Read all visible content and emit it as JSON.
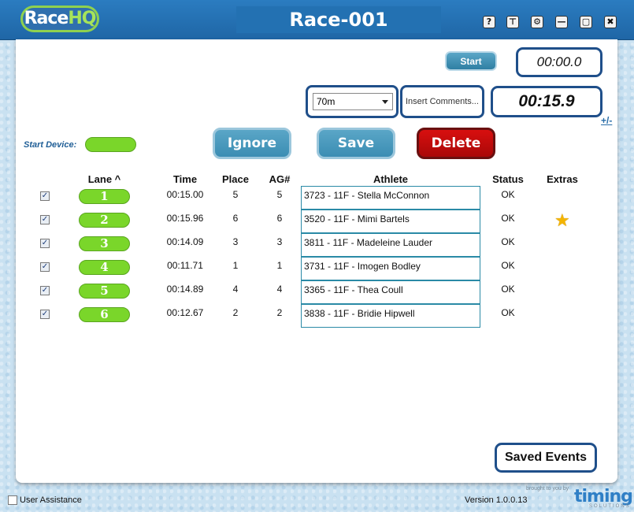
{
  "titlebar": {
    "logo_main": "Race",
    "logo_hq": "HQ",
    "title": "Race-001",
    "buttons": [
      {
        "name": "help-icon",
        "glyph": "?"
      },
      {
        "name": "filter-icon",
        "glyph": "⊤"
      },
      {
        "name": "gear-icon",
        "glyph": "⚙"
      },
      {
        "name": "minimize-icon",
        "glyph": "—"
      },
      {
        "name": "maximize-icon",
        "glyph": "▢"
      },
      {
        "name": "close-icon",
        "glyph": "✖"
      }
    ]
  },
  "controls": {
    "start_label": "Start",
    "timer_primary": "00:00.0",
    "timer_split": "00:15.9",
    "plus_minus": "+/-",
    "distance_selected": "70m",
    "comments_placeholder": "Insert Comments...",
    "start_device_label": "Start Device:",
    "ignore_label": "Ignore",
    "save_label": "Save",
    "delete_label": "Delete"
  },
  "table": {
    "headers": {
      "lane": "Lane ^",
      "time": "Time",
      "place": "Place",
      "ag": "AG#",
      "athlete": "Athlete",
      "status": "Status",
      "extras": "Extras"
    },
    "rows": [
      {
        "checked": true,
        "lane": "1",
        "time": "00:15.00",
        "place": "5",
        "ag": "5",
        "athlete": "3723 - 11F - Stella McConnon",
        "status": "OK",
        "extras_star": false
      },
      {
        "checked": true,
        "lane": "2",
        "time": "00:15.96",
        "place": "6",
        "ag": "6",
        "athlete": "3520 - 11F - Mimi Bartels",
        "status": "OK",
        "extras_star": true
      },
      {
        "checked": true,
        "lane": "3",
        "time": "00:14.09",
        "place": "3",
        "ag": "3",
        "athlete": "3811 - 11F - Madeleine Lauder",
        "status": "OK",
        "extras_star": false
      },
      {
        "checked": true,
        "lane": "4",
        "time": "00:11.71",
        "place": "1",
        "ag": "1",
        "athlete": "3731 - 11F - Imogen Bodley",
        "status": "OK",
        "extras_star": false
      },
      {
        "checked": true,
        "lane": "5",
        "time": "00:14.89",
        "place": "4",
        "ag": "4",
        "athlete": "3365 - 11F - Thea Coull",
        "status": "OK",
        "extras_star": false
      },
      {
        "checked": true,
        "lane": "6",
        "time": "00:12.67",
        "place": "2",
        "ag": "2",
        "athlete": "3838 - 11F - Bridie Hipwell",
        "status": "OK",
        "extras_star": false
      }
    ]
  },
  "saved_events_label": "Saved Events",
  "footer": {
    "user_assistance": "User Assistance",
    "version": "Version 1.0.0.13",
    "brought_by": "brought to you by",
    "brand": "timing",
    "brand_sub": "SOLUTIONS"
  },
  "colors": {
    "titlebar": "#2371b2",
    "accent_green": "#7ad62a",
    "button_blue": "#3b8db3",
    "delete_red": "#c00c0c",
    "border_navy": "#1f4f8a"
  }
}
